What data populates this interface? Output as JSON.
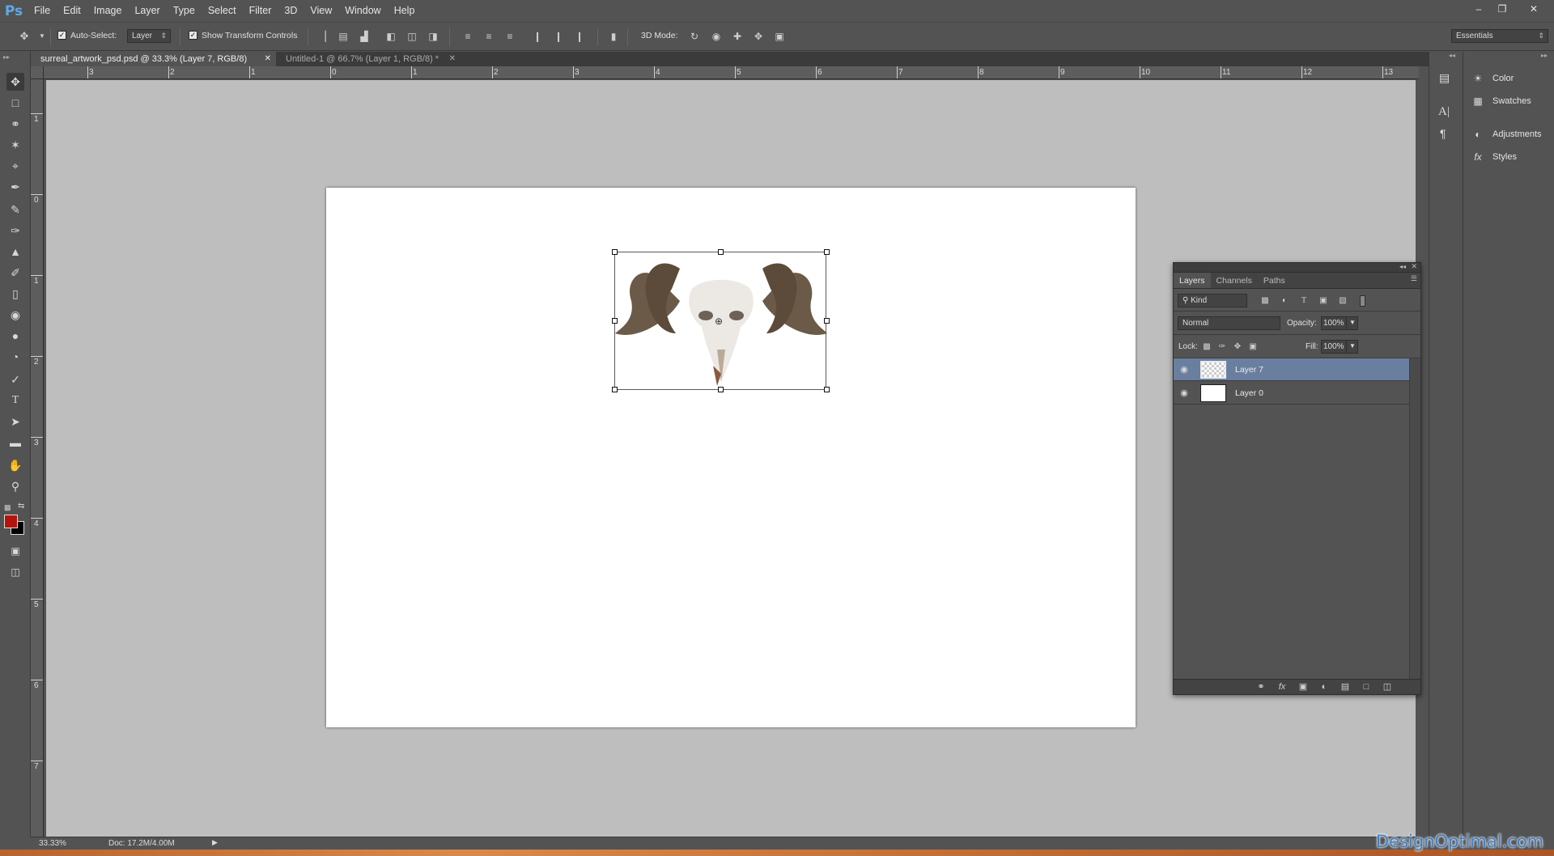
{
  "app": {
    "logo": "Ps"
  },
  "menu": [
    "File",
    "Edit",
    "Image",
    "Layer",
    "Type",
    "Select",
    "Filter",
    "3D",
    "View",
    "Window",
    "Help"
  ],
  "options_bar": {
    "auto_select_label": "Auto-Select:",
    "auto_select_checked": true,
    "auto_select_target": "Layer",
    "show_transform_label": "Show Transform Controls",
    "show_transform_checked": true,
    "mode_3d_label": "3D Mode:",
    "workspace": "Essentials"
  },
  "tabs": [
    {
      "label": "surreal_artwork_psd.psd @ 33.3% (Layer 7, RGB/8)",
      "active": true
    },
    {
      "label": "Untitled-1 @ 66.7% (Layer 1, RGB/8) *",
      "active": false
    }
  ],
  "ruler_h": [
    "3",
    "2",
    "1",
    "0",
    "1",
    "2",
    "3",
    "4",
    "5",
    "6",
    "7",
    "8",
    "9",
    "10",
    "11",
    "12",
    "13"
  ],
  "ruler_v": [
    "1",
    "0",
    "1",
    "2",
    "3",
    "4",
    "5",
    "6",
    "7"
  ],
  "right_dock": {
    "items": [
      {
        "label": "Color",
        "icon": "color-palette-icon"
      },
      {
        "label": "Swatches",
        "icon": "swatches-grid-icon"
      },
      {
        "label": "Adjustments",
        "icon": "adjustments-circle-icon"
      },
      {
        "label": "Styles",
        "icon": "fx-styles-icon"
      }
    ]
  },
  "layers_panel": {
    "tabs": [
      "Layers",
      "Channels",
      "Paths"
    ],
    "active_tab": "Layers",
    "filter_kind": "Kind",
    "blend_mode": "Normal",
    "opacity_label": "Opacity:",
    "opacity": "100%",
    "lock_label": "Lock:",
    "fill_label": "Fill:",
    "fill": "100%",
    "layers": [
      {
        "name": "Layer 7",
        "selected": true,
        "visible": true
      },
      {
        "name": "Layer 0",
        "selected": false,
        "visible": true
      }
    ]
  },
  "status": {
    "zoom": "33.33%",
    "doc": "Doc: 17.2M/4.00M"
  },
  "colors": {
    "foreground": "#b3150c",
    "background": "#000000",
    "selection": "#6a7fa0"
  },
  "watermark": "DesignOptimal.com"
}
